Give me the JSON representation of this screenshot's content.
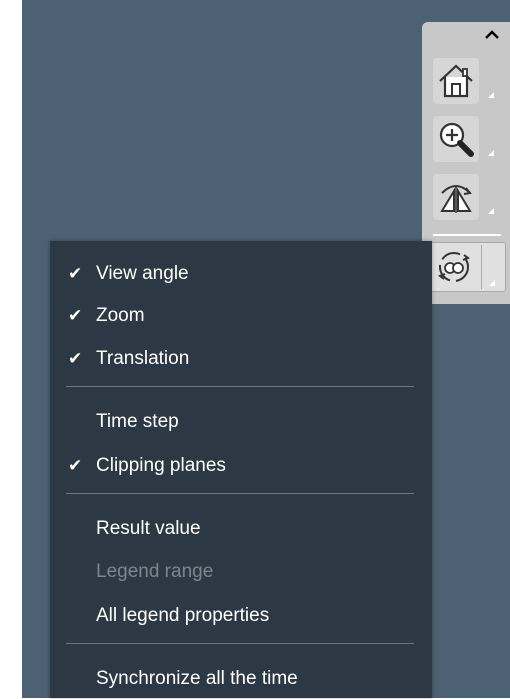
{
  "toolbar": {
    "collapse_icon": "chevron-up-icon",
    "tools": [
      {
        "name": "home-icon"
      },
      {
        "name": "zoom-icon"
      },
      {
        "name": "view-orientation-icon"
      },
      {
        "name": "synchronize-icon"
      }
    ]
  },
  "menu": {
    "items": [
      {
        "label": "View angle",
        "checked": true,
        "enabled": true
      },
      {
        "label": "Zoom",
        "checked": true,
        "enabled": true
      },
      {
        "label": "Translation",
        "checked": true,
        "enabled": true
      },
      {
        "label": "Time step",
        "checked": false,
        "enabled": true
      },
      {
        "label": "Clipping planes",
        "checked": true,
        "enabled": true
      },
      {
        "label": "Result value",
        "checked": false,
        "enabled": true
      },
      {
        "label": "Legend range",
        "checked": false,
        "enabled": false
      },
      {
        "label": "All legend properties",
        "checked": false,
        "enabled": true
      },
      {
        "label": "Synchronize all the time",
        "checked": false,
        "enabled": true
      }
    ],
    "check_glyph": "✔"
  },
  "colors": {
    "viewport_bg": "#4c6173",
    "menu_bg": "#2c3843",
    "toolbar_bg": "#c8c8c8",
    "disabled_text": "#7d868f"
  }
}
